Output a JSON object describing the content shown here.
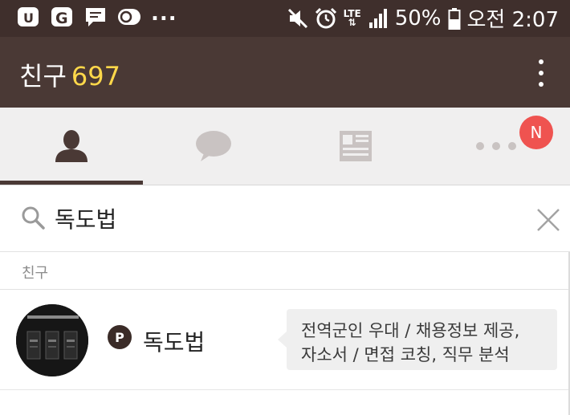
{
  "status_bar": {
    "left_icons": [
      "U+-app-icon",
      "g-app-icon",
      "message-icon",
      "c-app-icon"
    ],
    "more_dots": "...",
    "right_icons": [
      "mute-icon",
      "alarm-icon",
      "lte-icon",
      "signal-icon",
      "battery-icon"
    ],
    "lte": "LTE",
    "battery": "50%",
    "time": "오전 2:07"
  },
  "app_bar": {
    "title": "친구",
    "count": "697",
    "count_color": "#ffd84a",
    "background": "#4a3935"
  },
  "tabs": [
    {
      "name": "friends",
      "icon": "person-icon",
      "active": true
    },
    {
      "name": "chats",
      "icon": "chat-bubble-icon",
      "active": false
    },
    {
      "name": "news",
      "icon": "newspaper-icon",
      "active": false
    },
    {
      "name": "more",
      "icon": "more-dots-icon",
      "active": false
    }
  ],
  "notification_badge": "N",
  "search": {
    "value": "독도법"
  },
  "section": {
    "label": "친구"
  },
  "results": [
    {
      "name": "독도법",
      "type_badge": "P",
      "status_lines": [
        "전역군인 우대 / 채용정보 제공,",
        "자소서 / 면접 코칭, 직무 분석"
      ]
    }
  ]
}
